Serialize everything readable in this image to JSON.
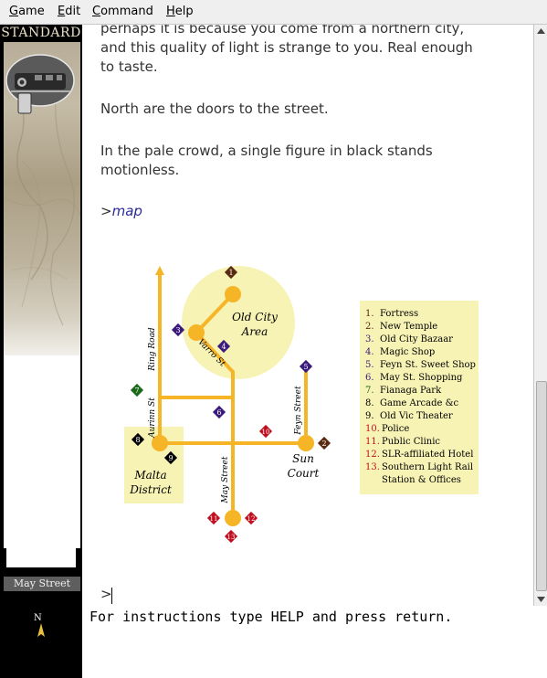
{
  "menubar": {
    "items": [
      {
        "accel": "G",
        "rest": "ame"
      },
      {
        "accel": "E",
        "rest": "dit"
      },
      {
        "accel": "C",
        "rest": "ommand"
      },
      {
        "accel": "H",
        "rest": "elp"
      }
    ]
  },
  "sidebar": {
    "banner": "STANDARD",
    "location": "May Street",
    "compass": "N"
  },
  "story": {
    "paragraphs": [
      "perhaps it is because you come from a northern city,",
      "and this quality of light is strange to you.  Real enough",
      "to taste.",
      "North are the doors to the street.",
      "In the pale crowd, a single figure in black stands",
      "motionless."
    ],
    "prompt_symbol": ">",
    "command": "map",
    "input_prompt": ">"
  },
  "map": {
    "area_labels": {
      "old_city_1": "Old City",
      "old_city_2": "Area",
      "sun_court_1": "Sun",
      "sun_court_2": "Court",
      "malta_1": "Malta",
      "malta_2": "District"
    },
    "street_labels": {
      "ring_road": "Ring Road",
      "varro_st": "Varro St",
      "aurinn_st": "Aurinn St",
      "feyn_street": "Feyn Street",
      "may_street": "May Street"
    },
    "markers": [
      "1",
      "2",
      "3",
      "4",
      "5",
      "6",
      "7",
      "8",
      "9",
      "10",
      "11",
      "12",
      "13"
    ],
    "legend": [
      {
        "num": "1.",
        "label": "Fortress",
        "color": "#5a2a10"
      },
      {
        "num": "2.",
        "label": "New Temple",
        "color": "#5a2a10"
      },
      {
        "num": "3.",
        "label": "Old City Bazaar",
        "color": "#3a1a7a"
      },
      {
        "num": "4.",
        "label": "Magic Shop",
        "color": "#3a1a7a"
      },
      {
        "num": "5.",
        "label": "Feyn St. Sweet Shop",
        "color": "#3a1a7a"
      },
      {
        "num": "6.",
        "label": "May St. Shopping",
        "color": "#3a1a7a"
      },
      {
        "num": "7.",
        "label": "Fianaga Park",
        "color": "#1a6a1a"
      },
      {
        "num": "8.",
        "label": "Game Arcade &c",
        "color": "#000000"
      },
      {
        "num": "9.",
        "label": "Old Vic Theater",
        "color": "#000000"
      },
      {
        "num": "10.",
        "label": "Police",
        "color": "#c01020"
      },
      {
        "num": "11.",
        "label": "Public Clinic",
        "color": "#c01020"
      },
      {
        "num": "12.",
        "label": "SLR-affiliated Hotel",
        "color": "#c01020"
      },
      {
        "num": "13.",
        "label": "Southern Light Rail",
        "color": "#c01020"
      },
      {
        "num": "",
        "label": "Station & Offices",
        "color": "#c01020"
      }
    ]
  },
  "status_line": "For instructions type HELP and press return.",
  "colors": {
    "road": "#f5b526",
    "area_fill": "#f7f3b5",
    "brown_marker": "#5a2a10",
    "purple_marker": "#3a1a7a",
    "green_marker": "#1a6a1a",
    "black_marker": "#000000",
    "red_marker": "#c01020"
  }
}
